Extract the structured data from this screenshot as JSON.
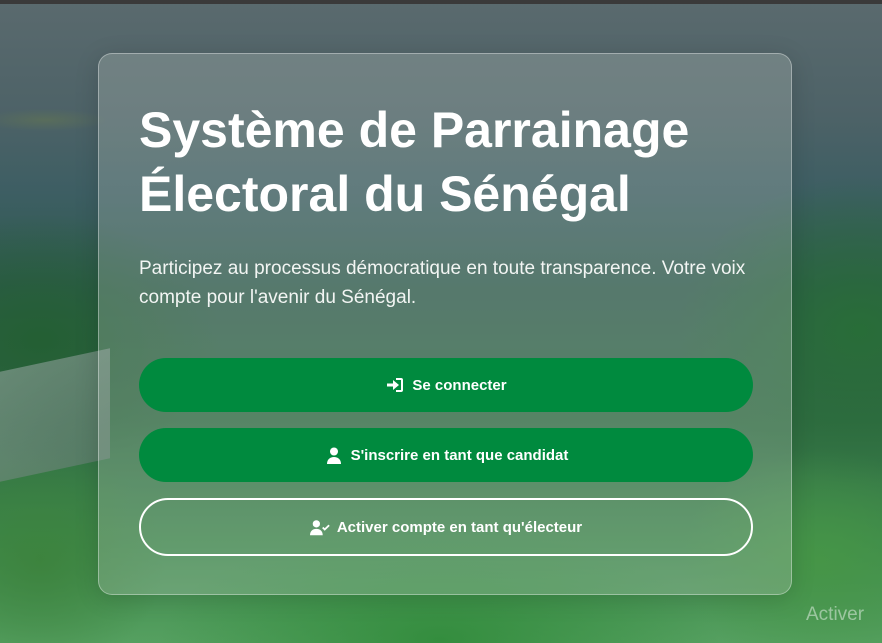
{
  "page": {
    "title": "Système de Parrainage Électoral du Sénégal",
    "subtitle": "Participez au processus démocratique en toute transparence. Votre voix compte pour l'avenir du Sénégal."
  },
  "buttons": {
    "login": {
      "label": "Se connecter",
      "icon": "sign-in-icon"
    },
    "register_candidate": {
      "label": "S'inscrire en tant que candidat",
      "icon": "user-icon"
    },
    "activate_voter": {
      "label": "Activer compte en tant qu'électeur",
      "icon": "user-check-icon"
    }
  },
  "watermark": {
    "text": "Activer"
  },
  "colors": {
    "primary": "#008a3e",
    "text": "#ffffff"
  }
}
